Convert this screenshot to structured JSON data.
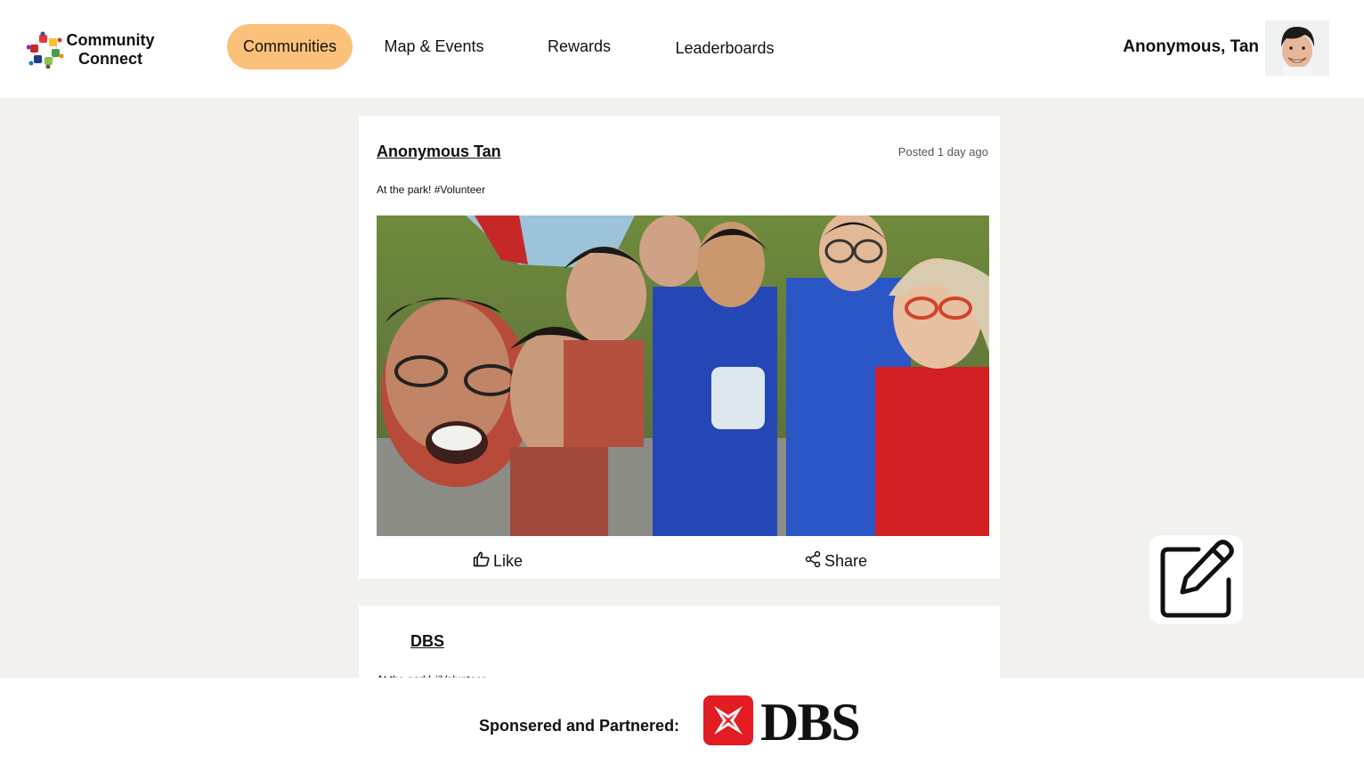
{
  "app": {
    "logo_text_line1": "Community",
    "logo_text_line2": "Connect"
  },
  "nav": {
    "items": [
      {
        "label": "Communities",
        "active": true
      },
      {
        "label": "Map & Events",
        "active": false
      },
      {
        "label": "Rewards",
        "active": false
      },
      {
        "label": "Leaderboards",
        "active": false
      }
    ]
  },
  "user": {
    "name": "Anonymous, Tan"
  },
  "posts": [
    {
      "author": "Anonymous Tan",
      "time": "Posted 1 day ago",
      "text": "At the park! #Volunteer",
      "like_label": "Like",
      "share_label": "Share"
    },
    {
      "author": "DBS",
      "text": "At the park! #Volunteer"
    }
  ],
  "footer": {
    "sponsor_label": "Sponsered and Partnered:",
    "partner_name": "DBS"
  },
  "colors": {
    "accent": "#fbc17a",
    "background": "#f2f1ed",
    "dbs_red": "#e31b23"
  },
  "icons": {
    "like": "thumbs-up-icon",
    "share": "share-icon",
    "compose": "edit-icon"
  }
}
